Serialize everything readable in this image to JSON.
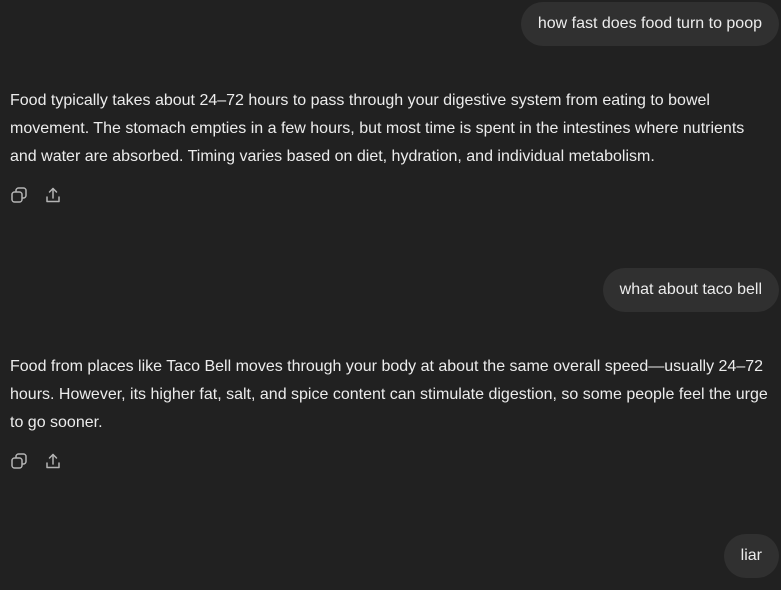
{
  "conversation": {
    "messages": [
      {
        "role": "user",
        "text": "how fast does food turn to poop"
      },
      {
        "role": "assistant",
        "text": "Food typically takes about 24–72 hours to pass through your digestive system from eating to bowel movement. The stomach empties in a few hours, but most time is spent in the intestines where nutrients and water are absorbed. Timing varies based on diet, hydration, and individual metabolism."
      },
      {
        "role": "user",
        "text": "what about taco bell"
      },
      {
        "role": "assistant",
        "text": "Food from places like Taco Bell moves through your body at about the same overall speed—usually 24–72 hours. However, its higher fat, salt, and spice content can stimulate digestion, so some people feel the urge to go sooner."
      },
      {
        "role": "user",
        "text": "liar"
      }
    ]
  },
  "actions": {
    "copy_icon": "copy-icon",
    "share_icon": "share-icon"
  },
  "colors": {
    "background": "#212121",
    "user_bubble": "#303030",
    "text": "#ececec",
    "icon": "#b4b4b4"
  }
}
